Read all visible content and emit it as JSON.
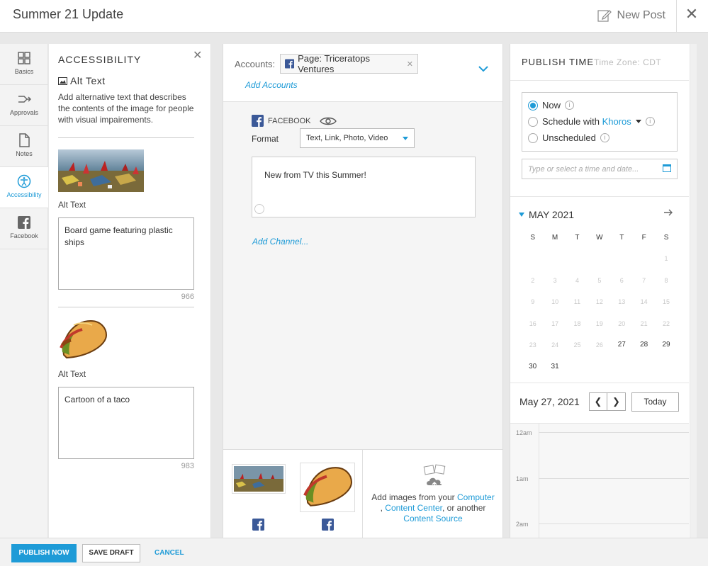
{
  "header": {
    "title": "Summer 21 Update",
    "new_post": "New Post"
  },
  "nav": [
    {
      "label": "Basics",
      "icon": "basics-icon"
    },
    {
      "label": "Approvals",
      "icon": "approvals-icon"
    },
    {
      "label": "Notes",
      "icon": "notes-icon"
    },
    {
      "label": "Accessibility",
      "icon": "accessibility-icon",
      "active": true
    },
    {
      "label": "Facebook",
      "icon": "facebook-icon"
    }
  ],
  "accessibility": {
    "title": "ACCESSIBILITY",
    "alt_heading": "Alt Text",
    "description": "Add alternative text that describes the contents of the image for people with visual impairements.",
    "images": [
      {
        "label": "Alt Text",
        "value": "Board game featuring plastic ships",
        "remaining": "966"
      },
      {
        "label": "Alt Text",
        "value": "Cartoon of a taco",
        "remaining": "983"
      }
    ]
  },
  "composer": {
    "accounts_label": "Accounts:",
    "account_chip": "Page: Triceratops Ventures",
    "add_accounts": "Add Accounts",
    "channel": "FACEBOOK",
    "format_label": "Format",
    "format_value": "Text, Link, Photo, Video",
    "message": "New from TV this Summer!",
    "add_channel": "Add Channel...",
    "upload_prefix": "Add images from your ",
    "upload_computer": "Computer",
    "upload_sep": ", ",
    "upload_content_center": "Content Center",
    "upload_mid": ", or another ",
    "upload_content_source": "Content Source"
  },
  "publish": {
    "title": "PUBLISH TIME",
    "timezone": "Time Zone: CDT",
    "options": {
      "now": "Now",
      "schedule": "Schedule with ",
      "schedule_brand": "Khoros",
      "unscheduled": "Unscheduled"
    },
    "date_placeholder": "Type or select a time and date...",
    "month": "MAY 2021",
    "dow": [
      "S",
      "M",
      "T",
      "W",
      "T",
      "F",
      "S"
    ],
    "weeks": [
      [
        "",
        "",
        "",
        "",
        "",
        "",
        "1"
      ],
      [
        "2",
        "3",
        "4",
        "5",
        "6",
        "7",
        "8"
      ],
      [
        "9",
        "10",
        "11",
        "12",
        "13",
        "14",
        "15"
      ],
      [
        "16",
        "17",
        "18",
        "19",
        "20",
        "21",
        "22"
      ],
      [
        "23",
        "24",
        "25",
        "26",
        "27",
        "28",
        "29"
      ],
      [
        "30",
        "31",
        "",
        "",
        "",
        "",
        ""
      ]
    ],
    "selected_date": "May 27, 2021",
    "today": "Today",
    "times": [
      "12am",
      "1am",
      "2am"
    ]
  },
  "footer": {
    "publish": "PUBLISH NOW",
    "draft": "SAVE DRAFT",
    "cancel": "CANCEL"
  },
  "colors": {
    "accent": "#1e9bd7",
    "facebook": "#3b5998"
  }
}
